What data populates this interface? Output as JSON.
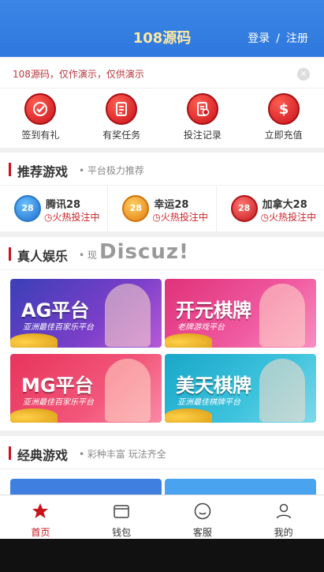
{
  "header": {
    "title": "108源码",
    "login": "登录",
    "sep": "/",
    "register": "注册"
  },
  "notice": {
    "text": "108源码，仅作演示，仅供演示"
  },
  "quick_actions": [
    {
      "label": "签到有礼",
      "icon": "check-badge-icon"
    },
    {
      "label": "有奖任务",
      "icon": "task-list-icon"
    },
    {
      "label": "投注记录",
      "icon": "record-icon"
    },
    {
      "label": "立即充值",
      "icon": "dollar-icon"
    }
  ],
  "recommended": {
    "title": "推荐游戏",
    "subtitle": "平台极力推荐",
    "games": [
      {
        "name": "腾讯28",
        "badge": "28",
        "status": "火热投注中"
      },
      {
        "name": "幸运28",
        "badge": "28",
        "status": "火热投注中"
      },
      {
        "name": "加拿大28",
        "badge": "28",
        "status": "火热投注中"
      }
    ]
  },
  "live": {
    "title": "真人娱乐",
    "subtitle": "现",
    "watermark": "Discuz!",
    "banners": [
      {
        "title": "AG平台",
        "subtitle": "亚洲最佳百家乐平台"
      },
      {
        "title": "开元棋牌",
        "subtitle": "老牌游戏平台"
      },
      {
        "title": "MG平台",
        "subtitle": "亚洲最佳百家乐平台"
      },
      {
        "title": "美天棋牌",
        "subtitle": "亚洲最佳棋牌平台"
      }
    ]
  },
  "classic": {
    "title": "经典游戏",
    "subtitle": "彩种丰富 玩法齐全"
  },
  "tabbar": [
    {
      "label": "首页",
      "icon": "star-icon"
    },
    {
      "label": "钱包",
      "icon": "wallet-icon"
    },
    {
      "label": "客服",
      "icon": "smile-icon"
    },
    {
      "label": "我的",
      "icon": "user-icon"
    }
  ],
  "colors": {
    "brand_blue": "#2f78de",
    "accent_red": "#c9131a",
    "title_gold": "#ffe9a0"
  }
}
